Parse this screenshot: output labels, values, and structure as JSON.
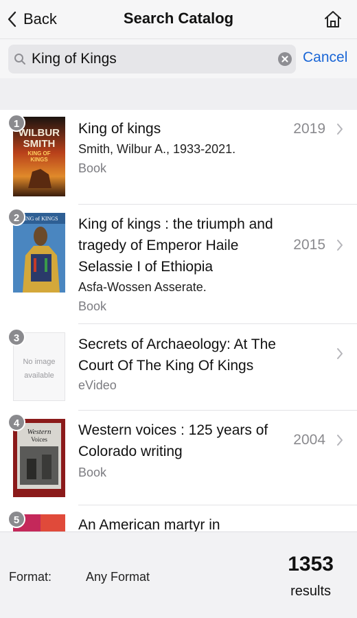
{
  "nav": {
    "back_label": "Back",
    "title": "Search Catalog"
  },
  "search": {
    "query": "King of Kings",
    "cancel_label": "Cancel"
  },
  "results": [
    {
      "num": "1",
      "title": "King of kings",
      "author": "Smith, Wilbur A., 1933-2021.",
      "format": "Book",
      "year": "2019",
      "cover_text": "WILBUR SMITH KING OF KINGS"
    },
    {
      "num": "2",
      "title": "King of kings : the triumph and tragedy of Emperor Haile Selassie I of Ethiopia",
      "author": "Asfa-Wossen Asserate.",
      "format": "Book",
      "year": "2015",
      "cover_text": "KING of KINGS"
    },
    {
      "num": "3",
      "title": "Secrets of Archaeology: At The Court Of The King Of Kings",
      "format": "eVideo",
      "year": "",
      "cover_text": "No image available"
    },
    {
      "num": "4",
      "title": "Western voices : 125 years of Colorado writing",
      "format": "Book",
      "year": "2004",
      "cover_text": "Western Voices"
    },
    {
      "num": "5",
      "title": "An American martyr in"
    }
  ],
  "footer": {
    "format_label": "Format:",
    "format_value": "Any Format",
    "count": "1353",
    "count_label": "results"
  },
  "colors": {
    "accent": "#1a66d6",
    "badge": "#8a8a8e"
  }
}
